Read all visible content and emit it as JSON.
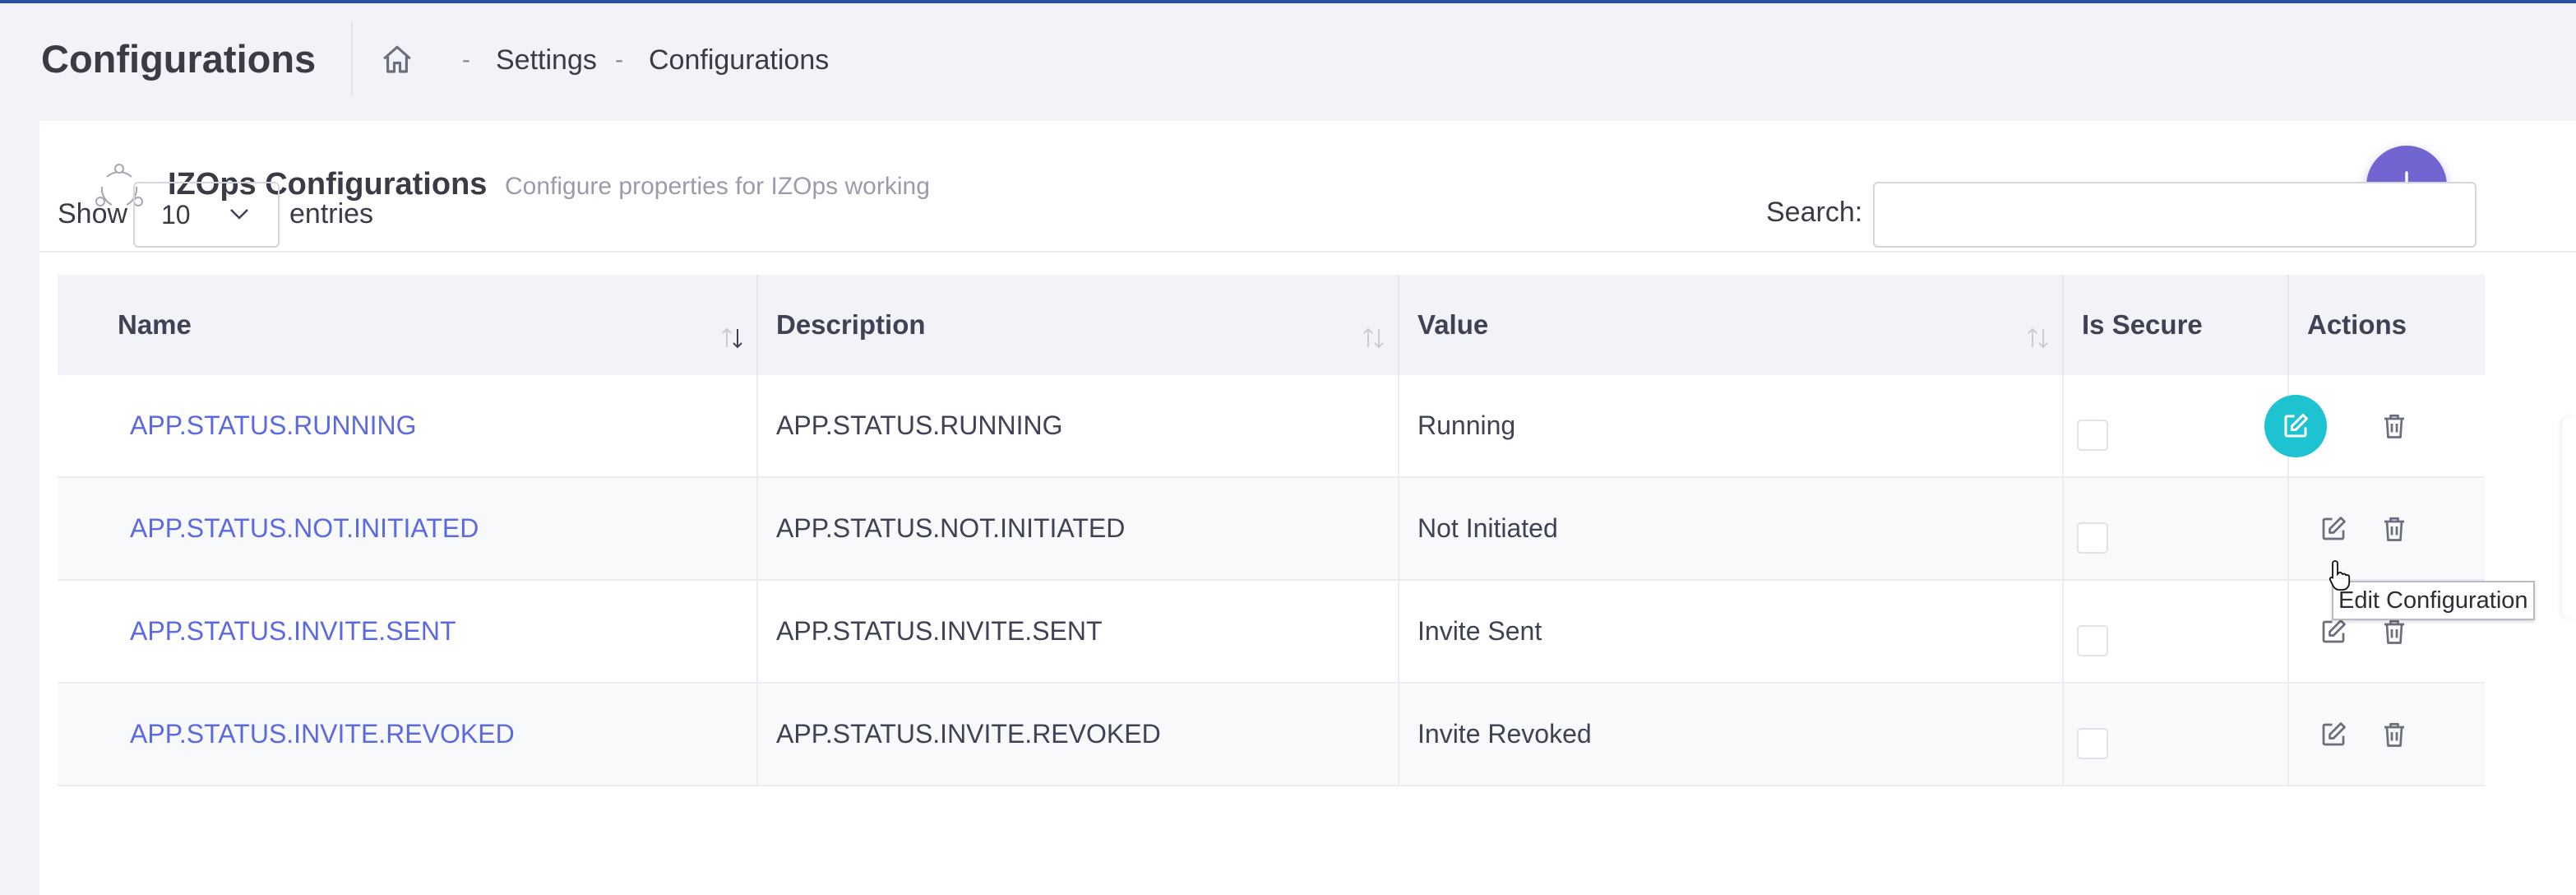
{
  "subheader": {
    "title": "Configurations",
    "breadcrumb": [
      {
        "label": "Settings"
      },
      {
        "label": "Configurations"
      }
    ],
    "breadcrumb_separator": "-"
  },
  "card": {
    "title": "IZOps Configurations",
    "subtitle": "Configure properties for IZOps working",
    "add_icon": "plus-icon"
  },
  "table_controls": {
    "show_label": "Show",
    "page_length": "10",
    "entries_label": "entries",
    "search_label": "Search:",
    "search_value": ""
  },
  "table": {
    "columns": [
      "Name",
      "Description",
      "Value",
      "Is Secure",
      "Actions"
    ],
    "rows": [
      {
        "name": "APP.STATUS.RUNNING",
        "description": "APP.STATUS.RUNNING",
        "value": "Running",
        "is_secure": false
      },
      {
        "name": "APP.STATUS.NOT.INITIATED",
        "description": "APP.STATUS.NOT.INITIATED",
        "value": "Not Initiated",
        "is_secure": false
      },
      {
        "name": "APP.STATUS.INVITE.SENT",
        "description": "APP.STATUS.INVITE.SENT",
        "value": "Invite Sent",
        "is_secure": false
      },
      {
        "name": "APP.STATUS.INVITE.REVOKED",
        "description": "APP.STATUS.INVITE.REVOKED",
        "value": "Invite Revoked",
        "is_secure": false
      }
    ]
  },
  "tooltip": {
    "text": "Edit Configuration"
  },
  "colors": {
    "accent": "#7165d1",
    "link": "#5b6ae0",
    "edit_active": "#1ec3d1",
    "topline": "#2a4fa0"
  }
}
